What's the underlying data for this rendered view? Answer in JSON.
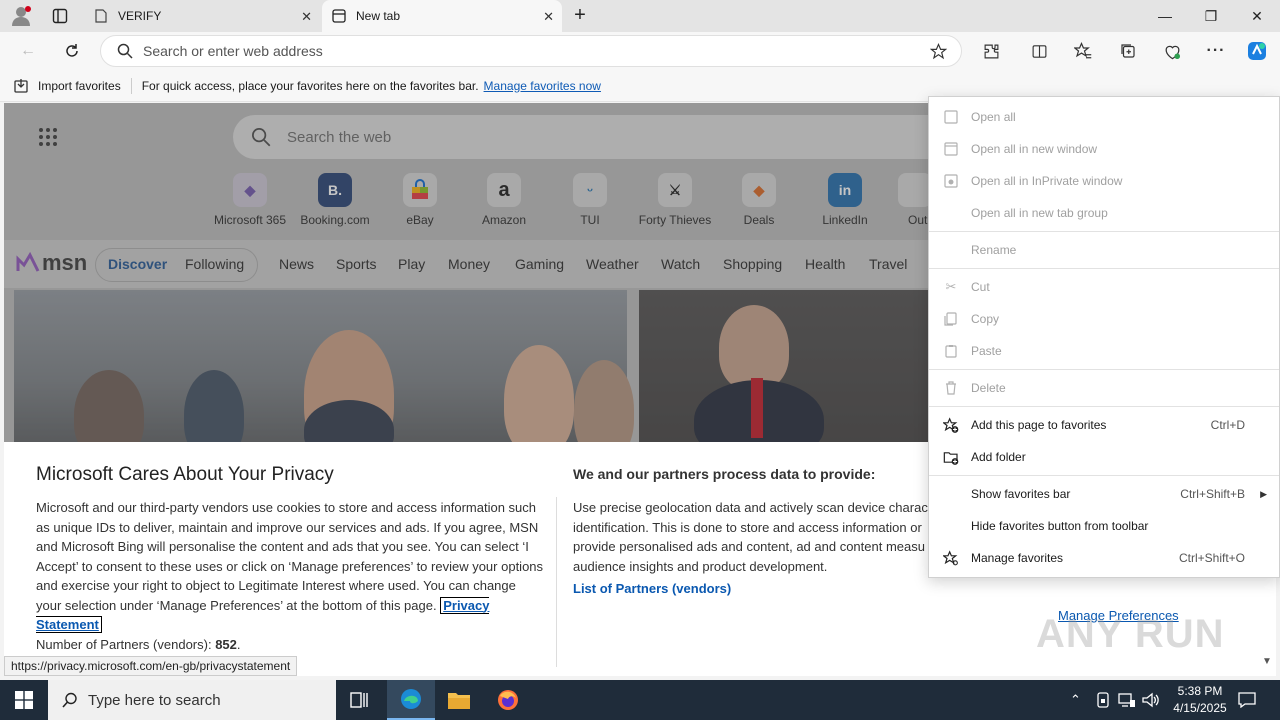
{
  "browser": {
    "tabs": [
      {
        "title": "VERIFY"
      },
      {
        "title": "New tab"
      }
    ],
    "address_placeholder": "Search or enter web address",
    "favorites_bar": {
      "import_label": "Import favorites",
      "hint": "For quick access, place your favorites here on the favorites bar.",
      "manage_link": "Manage favorites now"
    }
  },
  "newtab": {
    "search_placeholder": "Search the web",
    "quick_links": [
      "Microsoft 365",
      "Booking.com",
      "eBay",
      "Amazon",
      "TUI",
      "Forty Thieves",
      "Deals",
      "LinkedIn",
      "Out"
    ],
    "msn": {
      "logo": "msn",
      "nav": [
        "Discover",
        "Following",
        "News",
        "Sports",
        "Play",
        "Money",
        "Gaming",
        "Weather",
        "Watch",
        "Shopping",
        "Health",
        "Travel"
      ]
    }
  },
  "privacy_dialog": {
    "title": "Microsoft Cares About Your Privacy",
    "body_before_link": "Microsoft and our third-party vendors use cookies to store and access information such as unique IDs to deliver, maintain and improve our services and ads. If you agree, MSN and Microsoft Bing will personalise the content and ads that you see. You can select ‘I Accept’ to consent to these uses or click on ‘Manage preferences’ to review your options and exercise your right to object to Legitimate Interest where used.  You can change your selection under ‘Manage Preferences’ at the bottom of this page.",
    "privacy_link": "Privacy Statement",
    "partners_count_label": "Number of Partners (vendors):",
    "partners_count": "852",
    "right_title": "We and our partners process data to provide:",
    "right_body_lines": [
      "Use precise geolocation data and actively scan device charac",
      "identification. This is done to store and access information or",
      "provide personalised ads and content, ad and content measu",
      "audience insights and product development."
    ],
    "partners_link": "List of Partners (vendors)",
    "manage_preferences": "Manage Preferences"
  },
  "status_url": "https://privacy.microsoft.com/en-gb/privacystatement",
  "watermark": "ANY RUN",
  "context_menu": {
    "items": [
      {
        "label": "Open all",
        "shortcut": "",
        "disabled": true
      },
      {
        "label": "Open all in new window",
        "shortcut": "",
        "disabled": true
      },
      {
        "label": "Open all in InPrivate window",
        "shortcut": "",
        "disabled": true
      },
      {
        "label": "Open all in new tab group",
        "shortcut": "",
        "disabled": true
      },
      {
        "label": "Rename",
        "shortcut": "",
        "disabled": true
      },
      {
        "label": "Cut",
        "shortcut": "",
        "disabled": true
      },
      {
        "label": "Copy",
        "shortcut": "",
        "disabled": true
      },
      {
        "label": "Paste",
        "shortcut": "",
        "disabled": true
      },
      {
        "label": "Delete",
        "shortcut": "",
        "disabled": true
      },
      {
        "label": "Add this page to favorites",
        "shortcut": "Ctrl+D",
        "disabled": false
      },
      {
        "label": "Add folder",
        "shortcut": "",
        "disabled": false
      },
      {
        "label": "Show favorites bar",
        "shortcut": "Ctrl+Shift+B",
        "disabled": false
      },
      {
        "label": "Hide favorites button from toolbar",
        "shortcut": "",
        "disabled": false
      },
      {
        "label": "Manage favorites",
        "shortcut": "Ctrl+Shift+O",
        "disabled": false
      }
    ]
  },
  "taskbar": {
    "search_placeholder": "Type here to search",
    "time": "5:38 PM",
    "date": "4/15/2025"
  },
  "colors": {
    "accent": "#0a58b0",
    "taskbar": "#1f2c3a"
  }
}
